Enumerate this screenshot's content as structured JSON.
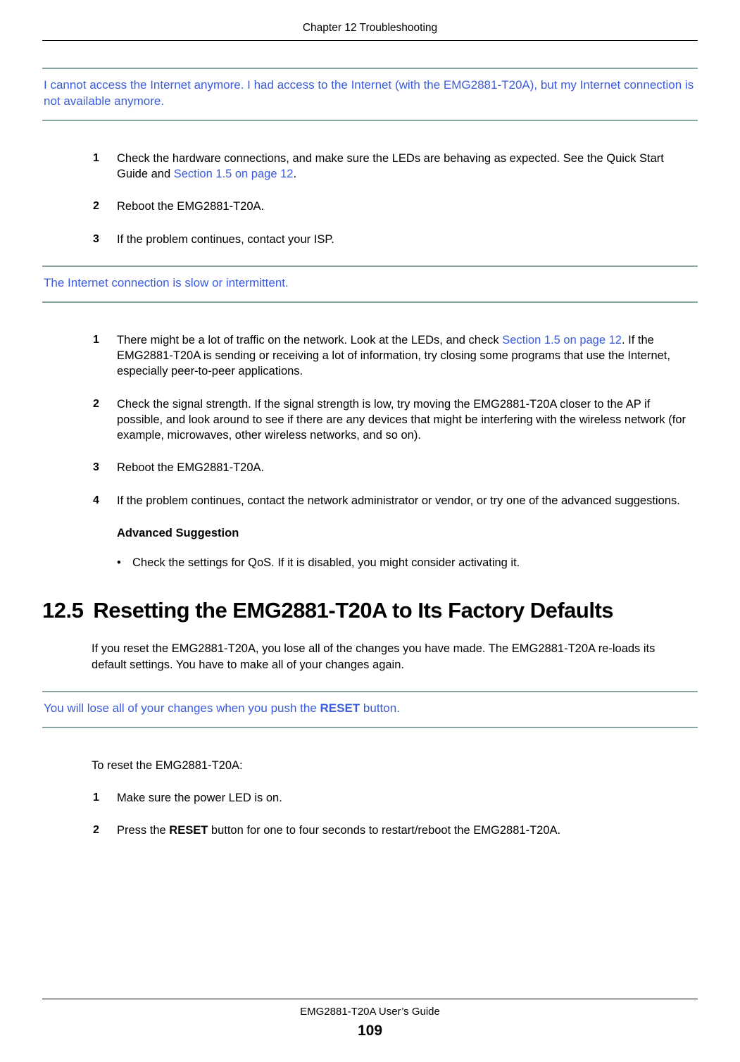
{
  "chapter_header": "Chapter 12 Troubleshooting",
  "callout1": {
    "text_a": "I cannot access the Internet anymore. I had access to the Internet (with the EMG2881-T20A), but my Internet connection is not available anymore."
  },
  "list1": {
    "items": [
      {
        "num": "1",
        "pre": "Check the hardware connections, and make sure the LEDs are behaving as expected. See the Quick Start Guide and ",
        "link": "Section 1.5 on page 12",
        "post": "."
      },
      {
        "num": "2",
        "pre": "Reboot the EMG2881-T20A.",
        "link": "",
        "post": ""
      },
      {
        "num": "3",
        "pre": "If the problem continues, contact your ISP.",
        "link": "",
        "post": ""
      }
    ]
  },
  "callout2": {
    "text": "The Internet connection is slow or intermittent."
  },
  "list2": {
    "items": [
      {
        "num": "1",
        "pre": "There might be a lot of traffic on the network. Look at the LEDs, and check ",
        "link": "Section 1.5 on page 12",
        "post": ". If the EMG2881-T20A is sending or receiving a lot of information, try closing some programs that use the Internet, especially peer-to-peer applications."
      },
      {
        "num": "2",
        "pre": "Check the signal strength. If the signal strength is low, try moving the EMG2881-T20A closer to the AP if possible, and look around to see if there are any devices that might be interfering with the wireless network (for example, microwaves, other wireless networks, and so on).",
        "link": "",
        "post": ""
      },
      {
        "num": "3",
        "pre": "Reboot the EMG2881-T20A.",
        "link": "",
        "post": ""
      },
      {
        "num": "4",
        "pre": "If the problem continues, contact the network administrator or vendor, or try one of the advanced suggestions.",
        "link": "",
        "post": ""
      }
    ],
    "advanced_heading": "Advanced Suggestion",
    "advanced_bullet": "Check the settings for QoS. If it is disabled, you might consider activating it."
  },
  "section_heading": {
    "num": "12.5",
    "title": "Resetting the EMG2881-T20A to Its Factory Defaults"
  },
  "para1": "If you reset the EMG2881-T20A, you lose all of the changes you have made. The EMG2881-T20A re-loads its default settings. You have to make all of your changes again.",
  "callout3": {
    "pre": "You will lose all of your changes when you push the ",
    "strong": "RESET",
    "post": " button."
  },
  "para2": "To reset the EMG2881-T20A:",
  "list3": {
    "items": [
      {
        "num": "1",
        "pre": "Make sure the power LED is on.",
        "strong": "",
        "post": ""
      },
      {
        "num": "2",
        "pre": "Press the ",
        "strong": "RESET",
        "post": " button for one to four seconds to restart/reboot the EMG2881-T20A."
      }
    ]
  },
  "footer": {
    "guide": "EMG2881-T20A User’s Guide",
    "page": "109"
  }
}
